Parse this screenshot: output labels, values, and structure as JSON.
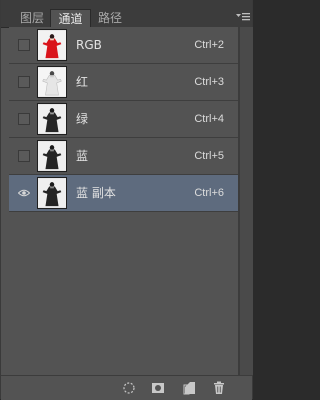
{
  "tabs": [
    {
      "label": "图层",
      "active": false
    },
    {
      "label": "通道",
      "active": true
    },
    {
      "label": "路径",
      "active": false
    }
  ],
  "channels": [
    {
      "label": "RGB",
      "shortcut": "Ctrl+2",
      "visible": false,
      "selected": false,
      "thumb": "color"
    },
    {
      "label": "红",
      "shortcut": "Ctrl+3",
      "visible": false,
      "selected": false,
      "thumb": "light"
    },
    {
      "label": "绿",
      "shortcut": "Ctrl+4",
      "visible": false,
      "selected": false,
      "thumb": "dark"
    },
    {
      "label": "蓝",
      "shortcut": "Ctrl+5",
      "visible": false,
      "selected": false,
      "thumb": "dark"
    },
    {
      "label": "蓝 副本",
      "shortcut": "Ctrl+6",
      "visible": true,
      "selected": true,
      "thumb": "dark"
    }
  ],
  "footer_icons": [
    "load-selection-icon",
    "save-selection-icon",
    "new-channel-icon",
    "delete-channel-icon"
  ],
  "colors": {
    "panel_bg": "#535353",
    "selected_row": "#5e6b7e",
    "accent_red": "#d9141b"
  }
}
